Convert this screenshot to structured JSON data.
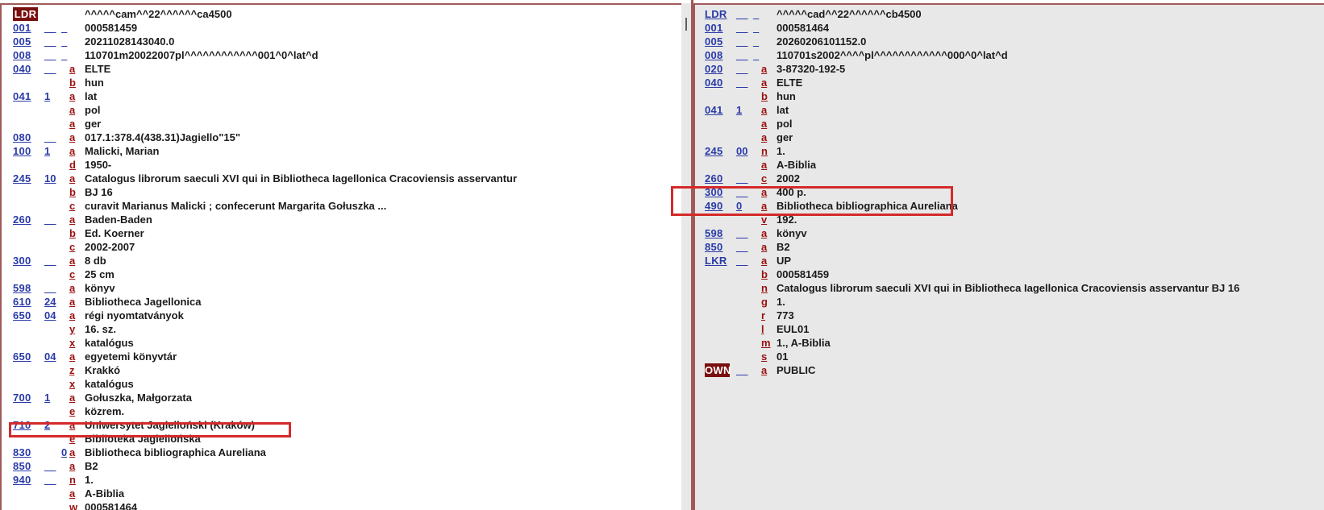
{
  "left_record": [
    {
      "tag": "LDR",
      "ind1": "",
      "ind2": "",
      "sub": "",
      "value": "^^^^^cam^^22^^^^^^ca4500",
      "tag_style": "highlight"
    },
    {
      "tag": "001",
      "ind1": "__",
      "ind2": "_",
      "sub": "",
      "value": "000581459"
    },
    {
      "tag": "005",
      "ind1": "__",
      "ind2": "_",
      "sub": "",
      "value": "20211028143040.0"
    },
    {
      "tag": "008",
      "ind1": "__",
      "ind2": "_",
      "sub": "",
      "value": "110701m20022007pl^^^^^^^^^^^^001^0^lat^d"
    },
    {
      "tag": "040",
      "ind1": "__",
      "ind2": "",
      "sub": "a",
      "value": "ELTE"
    },
    {
      "tag": "",
      "ind1": "",
      "ind2": "",
      "sub": "b",
      "value": "hun"
    },
    {
      "tag": "041",
      "ind1": "1",
      "ind2": "",
      "sub": "a",
      "value": "lat"
    },
    {
      "tag": "",
      "ind1": "",
      "ind2": "",
      "sub": "a",
      "value": "pol"
    },
    {
      "tag": "",
      "ind1": "",
      "ind2": "",
      "sub": "a",
      "value": "ger"
    },
    {
      "tag": "080",
      "ind1": "__",
      "ind2": "",
      "sub": "a",
      "value": "017.1:378.4(438.31)Jagiello\"15\""
    },
    {
      "tag": "100",
      "ind1": "1",
      "ind2": "",
      "sub": "a",
      "value": "Malicki, Marian"
    },
    {
      "tag": "",
      "ind1": "",
      "ind2": "",
      "sub": "d",
      "value": "1950-"
    },
    {
      "tag": "245",
      "ind1": "10",
      "ind2": "",
      "sub": "a",
      "value": "Catalogus librorum saeculi XVI qui in Bibliotheca Iagellonica Cracoviensis asservantur"
    },
    {
      "tag": "",
      "ind1": "",
      "ind2": "",
      "sub": "b",
      "value": "BJ 16"
    },
    {
      "tag": "",
      "ind1": "",
      "ind2": "",
      "sub": "c",
      "value": "curavit Marianus Malicki ; confecerunt Margarita Gołuszka ..."
    },
    {
      "tag": "260",
      "ind1": "__",
      "ind2": "",
      "sub": "a",
      "value": "Baden-Baden"
    },
    {
      "tag": "",
      "ind1": "",
      "ind2": "",
      "sub": "b",
      "value": "Ed. Koerner"
    },
    {
      "tag": "",
      "ind1": "",
      "ind2": "",
      "sub": "c",
      "value": "2002-2007"
    },
    {
      "tag": "300",
      "ind1": "__",
      "ind2": "",
      "sub": "a",
      "value": "8 db"
    },
    {
      "tag": "",
      "ind1": "",
      "ind2": "",
      "sub": "c",
      "value": "25 cm"
    },
    {
      "tag": "598",
      "ind1": "__",
      "ind2": "",
      "sub": "a",
      "value": "könyv"
    },
    {
      "tag": "610",
      "ind1": "24",
      "ind2": "",
      "sub": "a",
      "value": "Bibliotheca Jagellonica"
    },
    {
      "tag": "650",
      "ind1": "04",
      "ind2": "",
      "sub": "a",
      "value": "régi nyomtatványok"
    },
    {
      "tag": "",
      "ind1": "",
      "ind2": "",
      "sub": "y",
      "value": "16. sz."
    },
    {
      "tag": "",
      "ind1": "",
      "ind2": "",
      "sub": "x",
      "value": "katalógus"
    },
    {
      "tag": "650",
      "ind1": "04",
      "ind2": "",
      "sub": "a",
      "value": "egyetemi könyvtár"
    },
    {
      "tag": "",
      "ind1": "",
      "ind2": "",
      "sub": "z",
      "value": "Krakkó"
    },
    {
      "tag": "",
      "ind1": "",
      "ind2": "",
      "sub": "x",
      "value": "katalógus"
    },
    {
      "tag": "700",
      "ind1": "1",
      "ind2": "",
      "sub": "a",
      "value": "Gołuszka, Małgorzata"
    },
    {
      "tag": "",
      "ind1": "",
      "ind2": "",
      "sub": "e",
      "value": "közrem."
    },
    {
      "tag": "710",
      "ind1": "2",
      "ind2": "",
      "sub": "a",
      "value": "Uniwersytet Jagielloński (Kraków)"
    },
    {
      "tag": "",
      "ind1": "",
      "ind2": "",
      "sub": "e",
      "value": "Biblioteka Jagiellońska"
    },
    {
      "tag": "830",
      "ind1": "",
      "ind2": "0",
      "sub": "a",
      "value": "Bibliotheca bibliographica Aureliana"
    },
    {
      "tag": "850",
      "ind1": "__",
      "ind2": "",
      "sub": "a",
      "value": "B2"
    },
    {
      "tag": "940",
      "ind1": "__",
      "ind2": "",
      "sub": "n",
      "value": "1."
    },
    {
      "tag": "",
      "ind1": "",
      "ind2": "",
      "sub": "a",
      "value": "A-Biblia"
    },
    {
      "tag": "",
      "ind1": "",
      "ind2": "",
      "sub": "w",
      "value": "000581464"
    }
  ],
  "right_record": [
    {
      "tag": "LDR",
      "ind1": "__",
      "ind2": "_",
      "sub": "",
      "value": "^^^^^cad^^22^^^^^^cb4500"
    },
    {
      "tag": "001",
      "ind1": "__",
      "ind2": "_",
      "sub": "",
      "value": "000581464"
    },
    {
      "tag": "005",
      "ind1": "__",
      "ind2": "_",
      "sub": "",
      "value": "20260206101152.0"
    },
    {
      "tag": "008",
      "ind1": "__",
      "ind2": "_",
      "sub": "",
      "value": "110701s2002^^^^pl^^^^^^^^^^^^000^0^lat^d"
    },
    {
      "tag": "020",
      "ind1": "__",
      "ind2": "",
      "sub": "a",
      "value": "3-87320-192-5"
    },
    {
      "tag": "040",
      "ind1": "__",
      "ind2": "",
      "sub": "a",
      "value": "ELTE"
    },
    {
      "tag": "",
      "ind1": "",
      "ind2": "",
      "sub": "b",
      "value": "hun"
    },
    {
      "tag": "041",
      "ind1": "1",
      "ind2": "",
      "sub": "a",
      "value": "lat"
    },
    {
      "tag": "",
      "ind1": "",
      "ind2": "",
      "sub": "a",
      "value": "pol"
    },
    {
      "tag": "",
      "ind1": "",
      "ind2": "",
      "sub": "a",
      "value": "ger"
    },
    {
      "tag": "245",
      "ind1": "00",
      "ind2": "",
      "sub": "n",
      "value": "1."
    },
    {
      "tag": "",
      "ind1": "",
      "ind2": "",
      "sub": "a",
      "value": "A-Biblia"
    },
    {
      "tag": "260",
      "ind1": "__",
      "ind2": "",
      "sub": "c",
      "value": "2002"
    },
    {
      "tag": "300",
      "ind1": "__",
      "ind2": "",
      "sub": "a",
      "value": "400 p."
    },
    {
      "tag": "490",
      "ind1": "0",
      "ind2": "",
      "sub": "a",
      "value": "Bibliotheca bibliographica Aureliana"
    },
    {
      "tag": "",
      "ind1": "",
      "ind2": "",
      "sub": "v",
      "value": "192."
    },
    {
      "tag": "598",
      "ind1": "__",
      "ind2": "",
      "sub": "a",
      "value": "könyv"
    },
    {
      "tag": "850",
      "ind1": "__",
      "ind2": "",
      "sub": "a",
      "value": "B2"
    },
    {
      "tag": "LKR",
      "ind1": "__",
      "ind2": "",
      "sub": "a",
      "value": "UP"
    },
    {
      "tag": "",
      "ind1": "",
      "ind2": "",
      "sub": "b",
      "value": "000581459"
    },
    {
      "tag": "",
      "ind1": "",
      "ind2": "",
      "sub": "n",
      "value": "Catalogus librorum saeculi XVI qui in Bibliotheca Iagellonica Cracoviensis asservantur BJ 16"
    },
    {
      "tag": "",
      "ind1": "",
      "ind2": "",
      "sub": "g",
      "value": "1."
    },
    {
      "tag": "",
      "ind1": "",
      "ind2": "",
      "sub": "r",
      "value": "773"
    },
    {
      "tag": "",
      "ind1": "",
      "ind2": "",
      "sub": "l",
      "value": "EUL01"
    },
    {
      "tag": "",
      "ind1": "",
      "ind2": "",
      "sub": "m",
      "value": "1., A-Biblia"
    },
    {
      "tag": "",
      "ind1": "",
      "ind2": "",
      "sub": "s",
      "value": "01"
    },
    {
      "tag": "OWN",
      "ind1": "__",
      "ind2": "",
      "sub": "a",
      "value": "PUBLIC",
      "tag_style": "highlight"
    }
  ],
  "colors": {
    "tag": "#2a3aa8",
    "subfield": "#9a1010",
    "highlight_tag_bg": "#7a0f0f",
    "annotation_box": "#d42a2a",
    "right_pane_bg": "#e8e8e8"
  }
}
